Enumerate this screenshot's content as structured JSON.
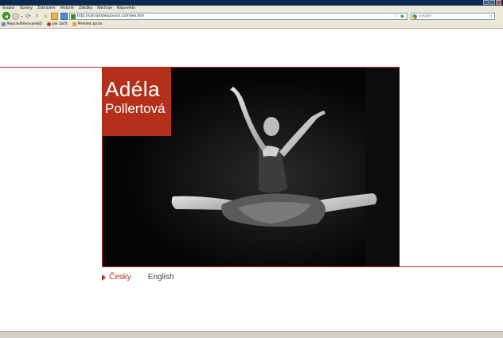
{
  "menu": {
    "items": [
      "Soubor",
      "Úpravy",
      "Zobrazení",
      "Historie",
      "Záložky",
      "Nástroje",
      "Nápověda"
    ]
  },
  "toolbar": {
    "url": "http://sahradatexpiance.cz/index.htm",
    "search_placeholder": "Google"
  },
  "bookmarks": {
    "items": [
      "Nejnavštěvovanější",
      "Jak začít",
      "Přehled zpráv"
    ]
  },
  "page": {
    "name_first": "Adéla",
    "name_last": "Pollertová",
    "lang_cs": "Česky",
    "lang_en": "English"
  },
  "colors": {
    "accent": "#b5301b",
    "photo_bg": "#050505"
  }
}
